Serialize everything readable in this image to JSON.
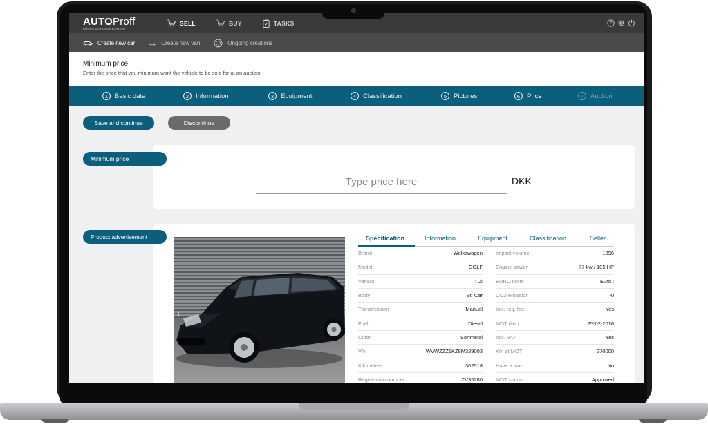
{
  "topnav": {
    "logo": {
      "part1": "AUTO",
      "part2": "Proff",
      "tagline": "EXPERT INFORMATION PLATFORM"
    },
    "items": [
      {
        "label": "SELL",
        "icon": "cart-sell-icon"
      },
      {
        "label": "BUY",
        "icon": "cart-buy-icon"
      },
      {
        "label": "TASKS",
        "icon": "clipboard-icon"
      }
    ],
    "right_icons": [
      "help-icon",
      "gear-icon",
      "power-icon"
    ]
  },
  "subnav": {
    "items": [
      {
        "label": "Create new car",
        "icon": "car-icon"
      },
      {
        "label": "Create new van",
        "icon": "van-icon"
      },
      {
        "label": "Ongoing creations",
        "icon": "spinner-icon"
      }
    ]
  },
  "header": {
    "title": "Minimum price",
    "description": "Enter the price that you minimum want the vehicle to be sold for at an auction."
  },
  "steps": [
    {
      "num": "1",
      "label": "Basic data"
    },
    {
      "num": "2",
      "label": "Information"
    },
    {
      "num": "3",
      "label": "Equipment"
    },
    {
      "num": "4",
      "label": "Classification"
    },
    {
      "num": "5",
      "label": "Pictures"
    },
    {
      "num": "6",
      "label": "Price"
    },
    {
      "num": "7",
      "label": "Auction"
    }
  ],
  "actions": {
    "save": "Save and continue",
    "discontinue": "Discontinue"
  },
  "price_section": {
    "label": "Minimum price",
    "placeholder": "Type price here",
    "currency": "DKK"
  },
  "product_section": {
    "label": "Product advertisement",
    "tabs": [
      "Specification",
      "Information",
      "Equipment",
      "Classification",
      "Seller"
    ],
    "left": [
      {
        "label": "Brand",
        "value": "Wolkswagen"
      },
      {
        "label": "Model",
        "value": "GOLF"
      },
      {
        "label": "Variant",
        "value": "TDI"
      },
      {
        "label": "Body",
        "value": "St. Car"
      },
      {
        "label": "Transmission",
        "value": "Manual"
      },
      {
        "label": "Fuel",
        "value": "Diesel"
      },
      {
        "label": "Color",
        "value": "Sortmetal"
      },
      {
        "label": "VIN",
        "value": "WVWZZZ1KZ8M329003"
      },
      {
        "label": "Kilometers",
        "value": "302518"
      },
      {
        "label": "Registration number",
        "value": "ZV35280"
      }
    ],
    "right": [
      {
        "label": "Impact volume",
        "value": "1896"
      },
      {
        "label": "Engine power",
        "value": "77 kw / 105 HP"
      },
      {
        "label": "EURO norm",
        "value": "Euro I"
      },
      {
        "label": "CO2-emission",
        "value": "-0"
      },
      {
        "label": "Incl. reg. fee",
        "value": "Yes"
      },
      {
        "label": "MOT dato",
        "value": "25-02-2016"
      },
      {
        "label": "Incl. VAT",
        "value": "Yes"
      },
      {
        "label": "Km at MOT",
        "value": "270000"
      },
      {
        "label": "Have a loan",
        "value": "No"
      },
      {
        "label": "MOT status",
        "value": "Approved"
      }
    ]
  }
}
